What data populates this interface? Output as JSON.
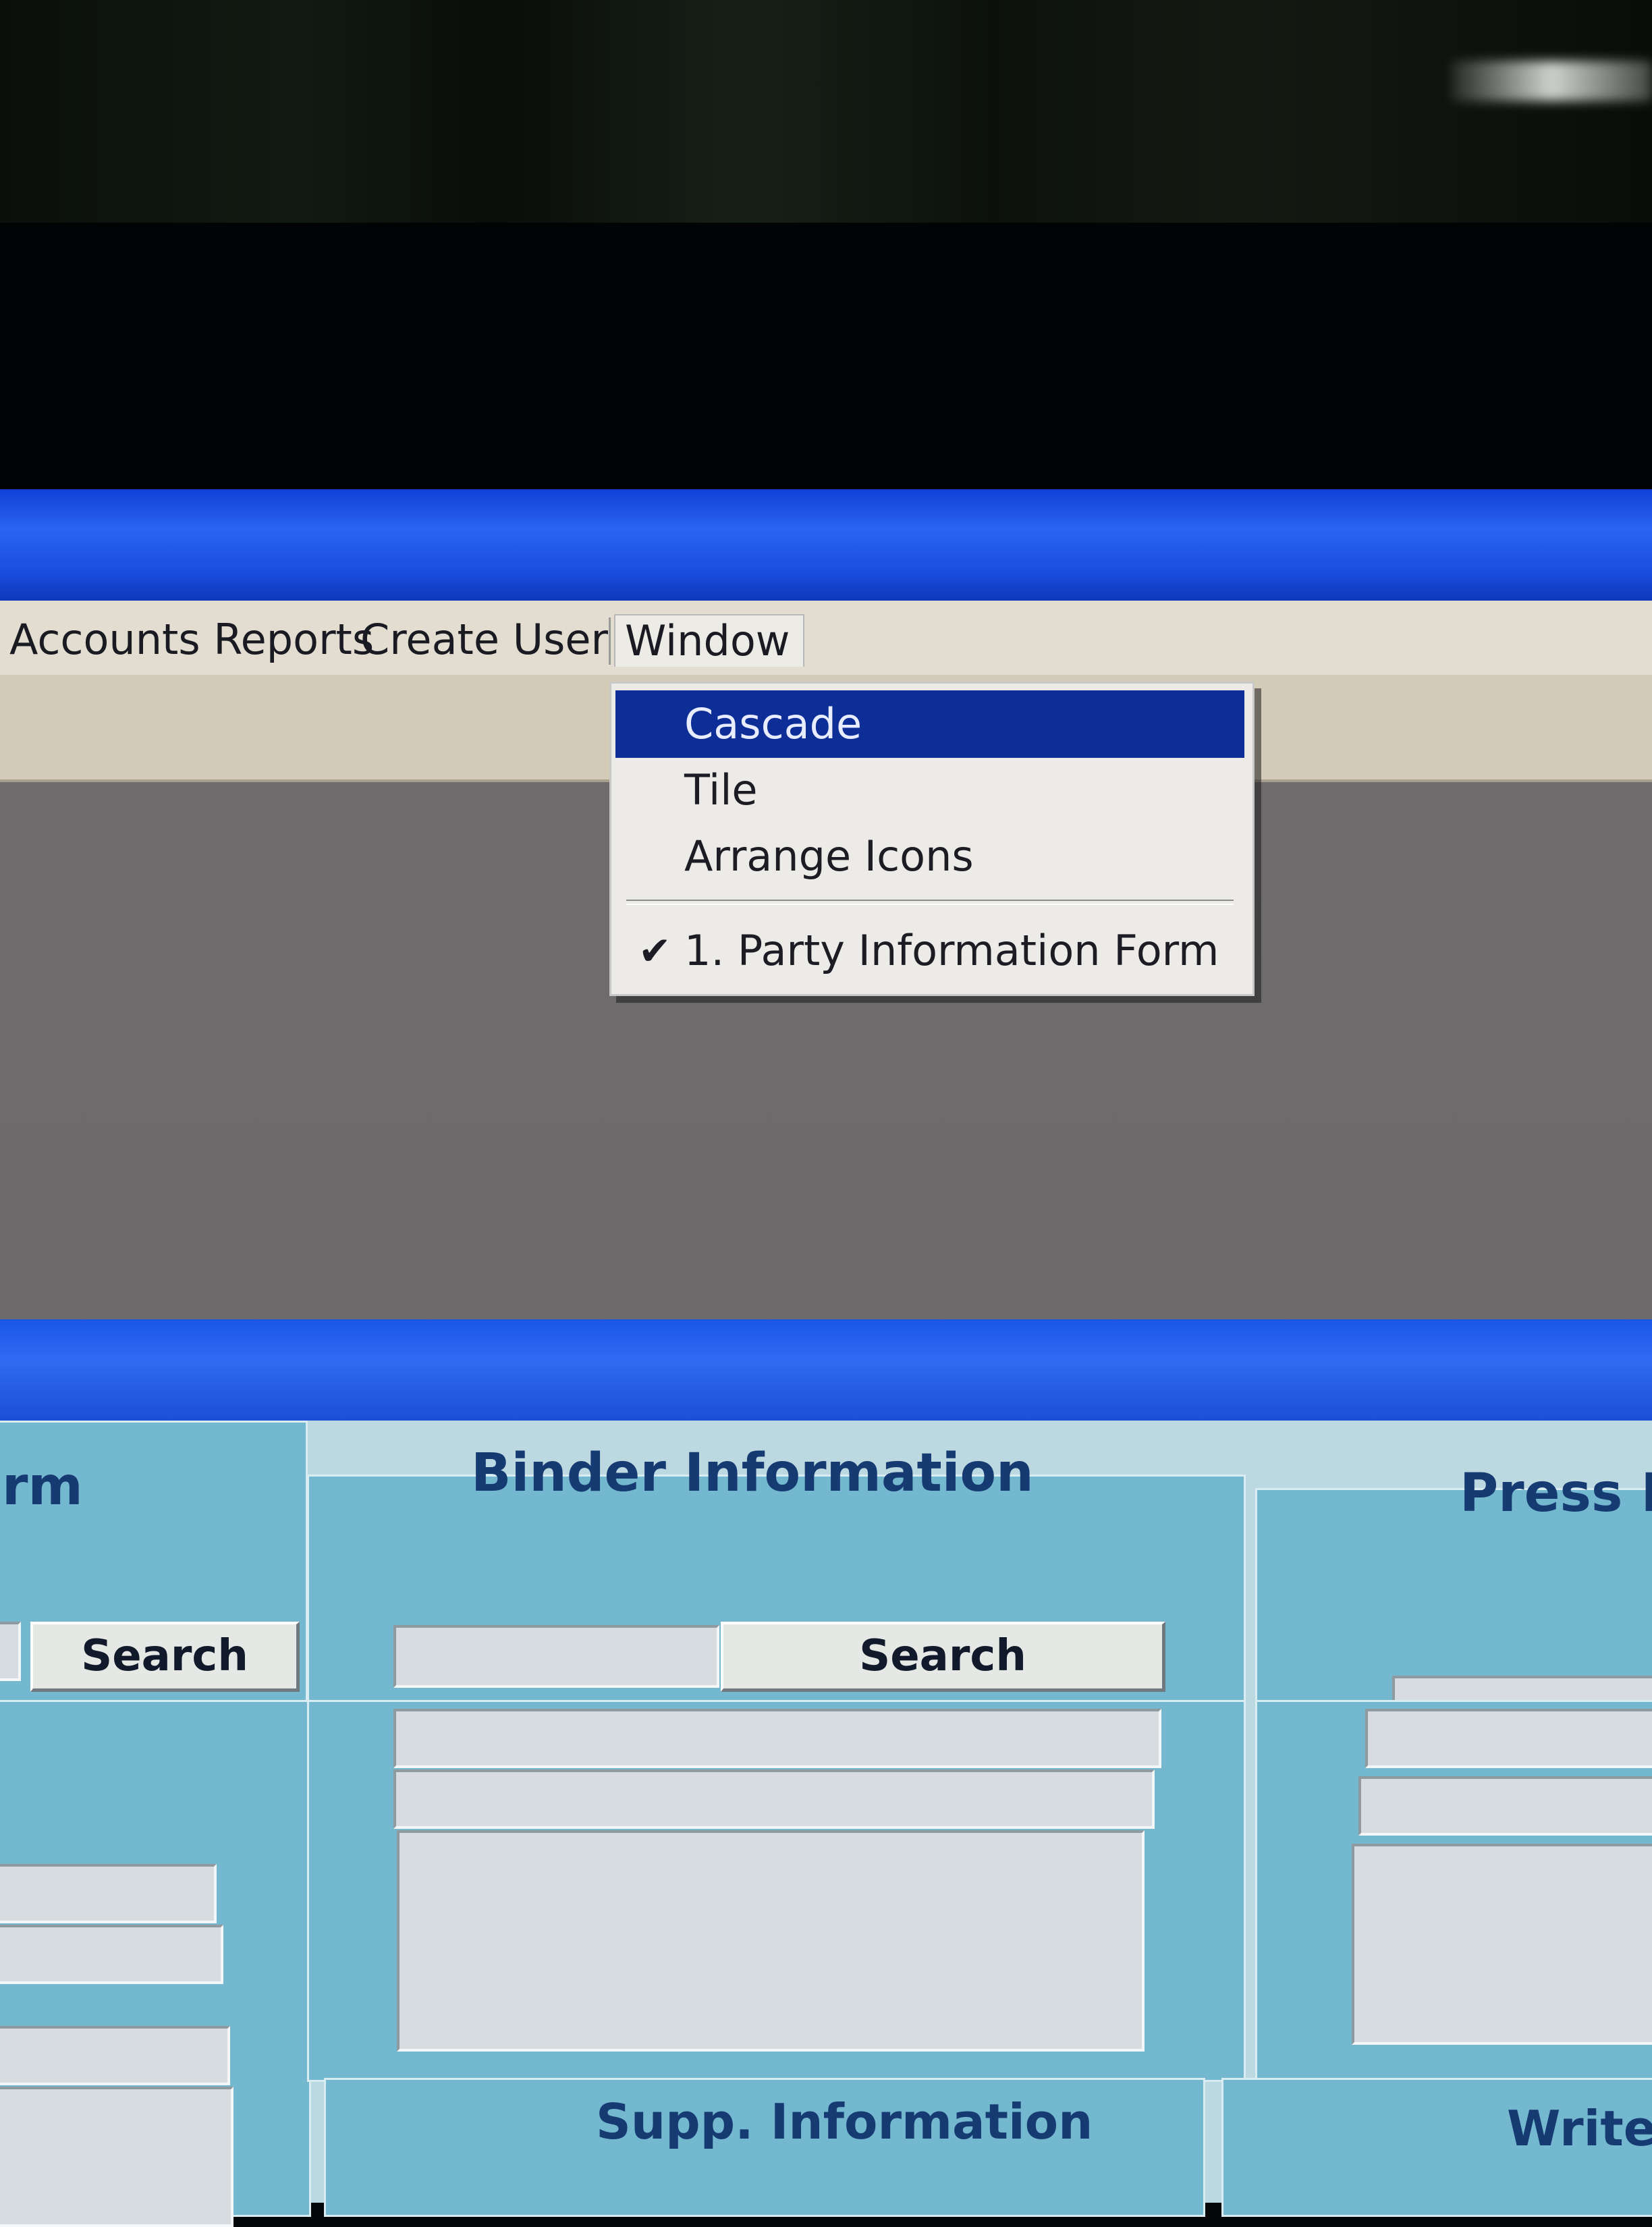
{
  "menubar": {
    "items": [
      "Accounts Reports",
      "Create User",
      "Window"
    ],
    "open_menu": "Window"
  },
  "window_menu": {
    "items": [
      {
        "label": "Cascade",
        "highlighted": true
      },
      {
        "label": "Tile"
      },
      {
        "label": "Arrange Icons"
      },
      {
        "label": "1. Party Information Form",
        "checked": true
      }
    ]
  },
  "form": {
    "left_panel_title_fragment": "rm",
    "left_search_label": "Search",
    "binder_title": "Binder Information",
    "binder_search_label": "Search",
    "press_title_fragment": "Press I",
    "supp_title": "Supp. Information",
    "write_title_fragment": "Write"
  },
  "colors": {
    "titlebar": "#2a64f0",
    "menu_highlight": "#0d2e96",
    "panel": "#74b8cf",
    "panel_title": "#163a72"
  },
  "icons": {
    "check": "checkmark-icon"
  }
}
